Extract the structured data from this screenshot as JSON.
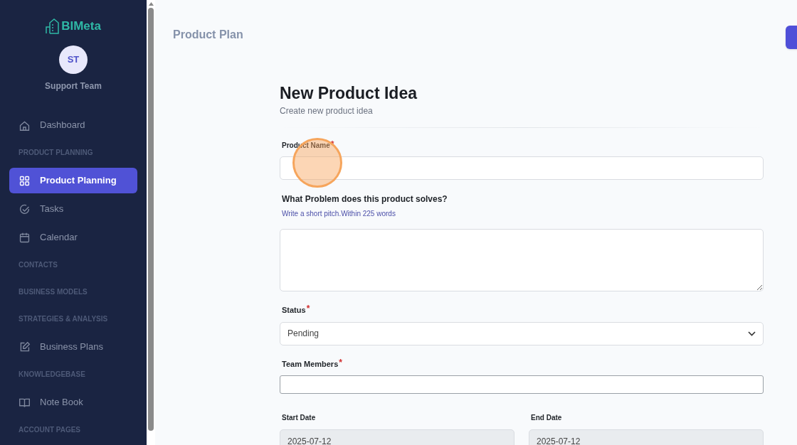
{
  "sidebar": {
    "logo": "BIMeta",
    "user": {
      "initials": "ST",
      "name": "Support Team"
    },
    "items": [
      {
        "kind": "link",
        "label": "Dashboard",
        "selected": false
      },
      {
        "kind": "section",
        "label": "PRODUCT PLANNING"
      },
      {
        "kind": "link",
        "label": "Product Planning",
        "selected": true
      },
      {
        "kind": "link",
        "label": "Tasks",
        "selected": false
      },
      {
        "kind": "link",
        "label": "Calendar",
        "selected": false
      },
      {
        "kind": "section",
        "label": "CONTACTS"
      },
      {
        "kind": "section",
        "label": "BUSINESS MODELS"
      },
      {
        "kind": "section",
        "label": "STRATEGIES & ANALYSIS"
      },
      {
        "kind": "link",
        "label": "Business Plans",
        "selected": false
      },
      {
        "kind": "section",
        "label": "KNOWLEDGEBASE"
      },
      {
        "kind": "link",
        "label": "Note Book",
        "selected": false
      },
      {
        "kind": "section",
        "label": "ACCOUNT PAGES"
      }
    ]
  },
  "page_title": "Product Plan",
  "form": {
    "title": "New Product Idea",
    "subtitle": "Create new product idea",
    "fields": [
      {
        "kind": "input",
        "label": "Product Name",
        "required_mark": "*"
      },
      {
        "kind": "textarea",
        "label": "What Problem does this product solves?",
        "hint": "Write a short pitch.Within 225 words"
      },
      {
        "kind": "select",
        "label": "Status",
        "required_mark": "*",
        "value": "Pending"
      },
      {
        "kind": "input",
        "label": "Team Members",
        "required_mark": "*"
      },
      {
        "kind": "dates",
        "items": [
          {
            "label": "Start Date",
            "value": "2025-07-12"
          },
          {
            "label": "End Date",
            "value": "2025-07-12"
          }
        ]
      }
    ]
  }
}
